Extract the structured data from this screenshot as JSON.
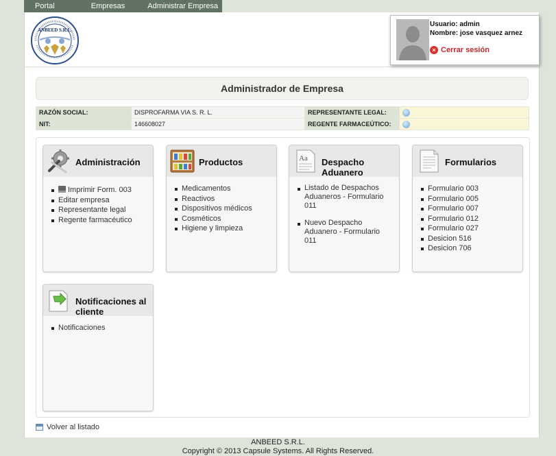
{
  "nav": {
    "items": [
      "Portal",
      "Empresas",
      "Administrar Empresa"
    ]
  },
  "user": {
    "usuario": "Usuario: admin",
    "nombre": "Nombre: jose vasquez arnez",
    "logout": "Cerrar sesión"
  },
  "page_title": "Administrador de Empresa",
  "company": {
    "razon_label": "RAZÓN SOCIAL:",
    "razon_value": "DISPROFARMA VIA S. R. L.",
    "nit_label": "NIT:",
    "nit_value": "146608027",
    "rep_label": "REPRESENTANTE LEGAL:",
    "regente_label": "REGENTE FARMACEÚTICO:"
  },
  "cards": {
    "admin": {
      "title": "Administración",
      "items": [
        "Imprimir Form. 003",
        "Editar empresa",
        "Representante legal",
        "Regente farmacéutico"
      ]
    },
    "productos": {
      "title": "Productos",
      "items": [
        "Medicamentos",
        "Reactivos",
        "Dispositivos médicos",
        "Cosméticos",
        "Higiene y limpieza"
      ]
    },
    "despacho": {
      "title_line1": "Despacho",
      "title_line2": "Aduanero",
      "items": [
        "Listado de Despachos Aduaneros - Formulario 011",
        "Nuevo Despacho Aduanero - Formulario 011"
      ]
    },
    "formularios": {
      "title": "Formularios",
      "items": [
        "Formulario 003",
        "Formulario 005",
        "Formulario 007",
        "Formulario 012",
        "Formulario 027",
        "Desicion 516",
        "Desicion 706"
      ]
    },
    "notificaciones": {
      "title_line1": "Notificaciones al",
      "title_line2": "cliente",
      "items": [
        "Notificaciones"
      ]
    }
  },
  "back_link": "Volver al listado",
  "footer": {
    "company": "ANBEED S.R.L.",
    "copyright": "Copyright © 2013 Capsule Systems. All Rights Reserved."
  },
  "colors": {
    "nav_bg": "#627262",
    "label_bg": "#dde4d6",
    "highlight_bg": "#fbf5d8",
    "logout_red": "#c0272d"
  }
}
